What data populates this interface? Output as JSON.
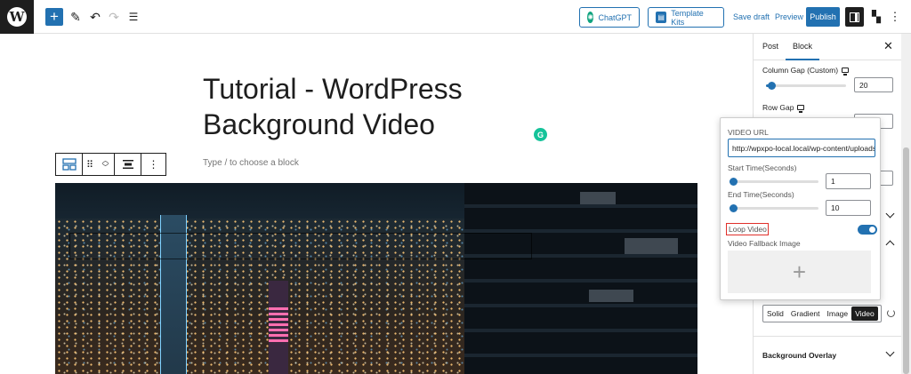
{
  "topbar": {
    "logo_glyph": "W",
    "chatgpt_label": "ChatGPT",
    "template_kits_label": "Template Kits",
    "save_draft_label": "Save draft",
    "preview_label": "Preview",
    "publish_label": "Publish"
  },
  "editor": {
    "post_title": "Tutorial - WordPress Background Video",
    "block_placeholder": "Type / to choose a block"
  },
  "sidebar": {
    "tabs": [
      {
        "label": "Post"
      },
      {
        "label": "Block"
      }
    ],
    "active_tab": "Block",
    "column_gap_label": "Column Gap (Custom)",
    "column_gap_value": "20",
    "row_gap_label": "Row Gap",
    "background_types": [
      "Solid",
      "Gradient",
      "Image",
      "Video"
    ],
    "active_background_type": "Video",
    "background_overlay_label": "Background Overlay"
  },
  "video_popover": {
    "video_url_label": "VIDEO URL",
    "video_url_value": "http://wpxpo-local.local/wp-content/uploads",
    "start_time_label": "Start Time(Seconds)",
    "start_time_value": "1",
    "end_time_label": "End Time(Seconds)",
    "end_time_value": "10",
    "loop_video_label": "Loop Video",
    "loop_video_enabled": true,
    "fallback_image_label": "Video Fallback Image"
  },
  "colors": {
    "accent": "#2271b1",
    "dark": "#1e1e1e",
    "highlight_border": "#e0302b"
  }
}
